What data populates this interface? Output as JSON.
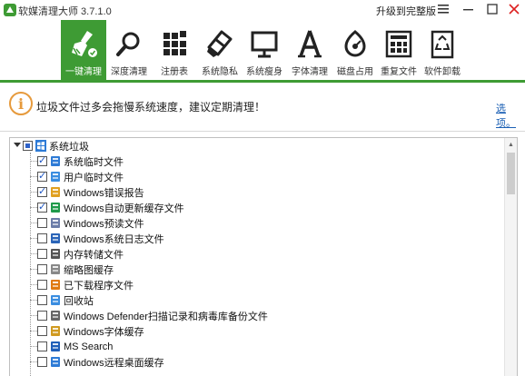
{
  "window": {
    "title": "软媒清理大师 3.7.1.0",
    "upgrade_label": "升级到完整版",
    "menu_icon": "menu-icon",
    "minimize_icon": "minimize-icon",
    "maximize_icon": "maximize-icon",
    "close_icon": "close-icon"
  },
  "toolbar": {
    "accent_color": "#3e9b34",
    "items": [
      {
        "label": "一键清理",
        "icon": "broom-icon",
        "active": true
      },
      {
        "label": "深度清理",
        "icon": "magnifier-icon",
        "active": false
      },
      {
        "label": "注册表",
        "icon": "registry-blocks-icon",
        "active": false
      },
      {
        "label": "系统隐私",
        "icon": "eraser-icon",
        "active": false
      },
      {
        "label": "系统瘦身",
        "icon": "monitor-icon",
        "active": false
      },
      {
        "label": "字体清理",
        "icon": "font-a-icon",
        "active": false
      },
      {
        "label": "磁盘占用",
        "icon": "disk-usage-icon",
        "active": false
      },
      {
        "label": "重复文件",
        "icon": "duplicate-files-icon",
        "active": false
      },
      {
        "label": "软件卸载",
        "icon": "recycle-bin-icon",
        "active": false
      }
    ]
  },
  "notice": {
    "text": "垃圾文件过多会拖慢系统速度，建议定期清理！",
    "options_link": "选项。",
    "icon": "exclamation-circle-icon"
  },
  "tree": {
    "root": {
      "label": "系统垃圾",
      "state": "partial",
      "icon": "windows-icon"
    },
    "items": [
      {
        "label": "系统临时文件",
        "checked": true,
        "icon": "windows-temp-icon"
      },
      {
        "label": "用户临时文件",
        "checked": true,
        "icon": "users-icon"
      },
      {
        "label": "Windows错误报告",
        "checked": true,
        "icon": "warning-icon"
      },
      {
        "label": "Windows自动更新缓存文件",
        "checked": true,
        "icon": "update-globe-icon"
      },
      {
        "label": "Windows预读文件",
        "checked": false,
        "icon": "prefetch-icon"
      },
      {
        "label": "Windows系统日志文件",
        "checked": false,
        "icon": "log-file-icon"
      },
      {
        "label": "内存转储文件",
        "checked": false,
        "icon": "memory-dump-icon"
      },
      {
        "label": "缩略图缓存",
        "checked": false,
        "icon": "thumbnail-icon"
      },
      {
        "label": "已下载程序文件",
        "checked": false,
        "icon": "download-icon"
      },
      {
        "label": "回收站",
        "checked": false,
        "icon": "recycle-icon"
      },
      {
        "label": "Windows Defender扫描记录和病毒库备份文件",
        "checked": false,
        "icon": "defender-icon"
      },
      {
        "label": "Windows字体缓存",
        "checked": false,
        "icon": "font-cache-icon"
      },
      {
        "label": "MS Search",
        "checked": false,
        "icon": "search-icon"
      },
      {
        "label": "Windows远程桌面缓存",
        "checked": false,
        "icon": "remote-desktop-icon"
      }
    ]
  }
}
